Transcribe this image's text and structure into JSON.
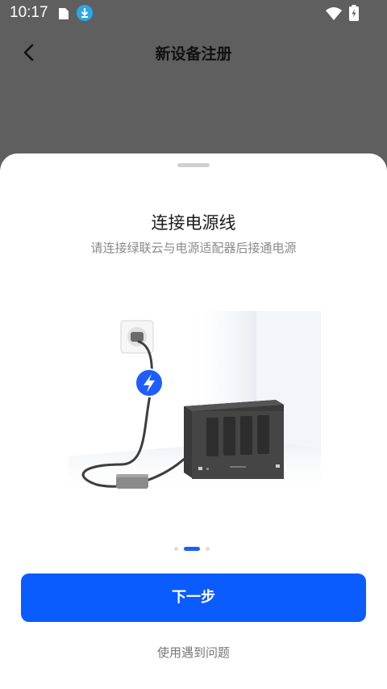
{
  "status_bar": {
    "time": "10:17",
    "icons": [
      "sim-card-icon",
      "download-icon",
      "wifi-icon",
      "battery-charging-icon"
    ],
    "download_color": "#29a8e8"
  },
  "nav": {
    "title": "新设备注册",
    "back_icon": "chevron-left-icon"
  },
  "sheet": {
    "title": "连接电源线",
    "subtitle": "请连接绿联云与电源适配器后接通电源",
    "illustration_icons": [
      "wall-outlet-icon",
      "power-bolt-icon",
      "power-adapter-icon",
      "nas-device-icon"
    ],
    "pager": {
      "count": 3,
      "active_index": 1
    },
    "next_label": "下一步",
    "help_label": "使用遇到问题"
  },
  "colors": {
    "accent": "#0a5cff",
    "overlay": "#5f5f5f",
    "bolt_badge": "#1e5eff"
  }
}
